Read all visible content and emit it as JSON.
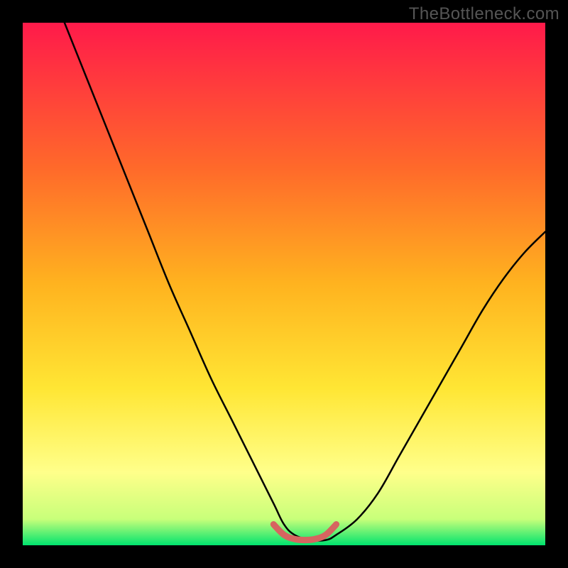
{
  "watermark": "TheBottleneck.com",
  "colors": {
    "bg_black": "#000000",
    "curve": "#000000",
    "ridge": "#d66560",
    "grad_top": "#ff1a4a",
    "grad_mid1": "#ff8a2a",
    "grad_mid2": "#ffd21f",
    "grad_mid3": "#ffff66",
    "grad_bottom": "#00e36e",
    "watermark": "#555555"
  },
  "chart_data": {
    "type": "line",
    "title": "",
    "xlabel": "",
    "ylabel": "",
    "xlim": [
      0,
      100
    ],
    "ylim": [
      0,
      100
    ],
    "series": [
      {
        "name": "bottleneck-curve",
        "x": [
          8,
          12,
          16,
          20,
          24,
          28,
          32,
          36,
          40,
          44,
          48,
          50,
          52,
          55,
          58,
          60,
          64,
          68,
          72,
          76,
          80,
          84,
          88,
          92,
          96,
          100
        ],
        "y": [
          100,
          90,
          80,
          70,
          60,
          50,
          41,
          32,
          24,
          16,
          8,
          4,
          2,
          1,
          1,
          2,
          5,
          10,
          17,
          24,
          31,
          38,
          45,
          51,
          56,
          60
        ]
      },
      {
        "name": "bottom-ridge",
        "x": [
          48,
          50,
          52,
          54,
          56,
          58,
          60
        ],
        "y": [
          4,
          2,
          1.2,
          1,
          1.2,
          2,
          4
        ]
      }
    ],
    "annotations": [
      {
        "text": "TheBottleneck.com",
        "position": "top-right"
      }
    ]
  }
}
